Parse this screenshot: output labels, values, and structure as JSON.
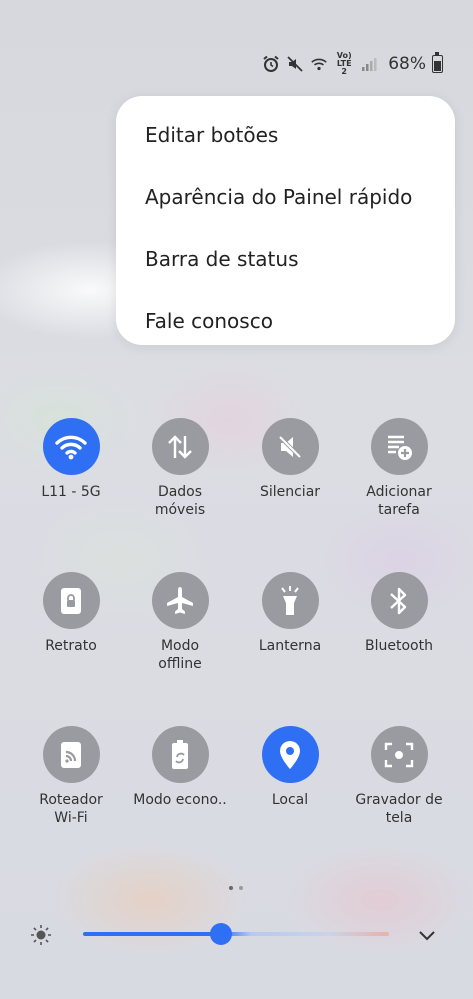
{
  "status_bar": {
    "battery_percent": "68%",
    "network_label": "Vo) LTE2",
    "icons": [
      "alarm-icon",
      "mute-icon",
      "wifi-icon",
      "lte-icon",
      "signal-icon",
      "battery-icon"
    ]
  },
  "menu": {
    "items": [
      {
        "label": "Editar botões"
      },
      {
        "label": "Aparência do Painel rápido"
      },
      {
        "label": "Barra de status"
      },
      {
        "label": "Fale conosco"
      }
    ]
  },
  "tiles": [
    {
      "label": "L11 - 5G",
      "active": true,
      "icon": "wifi-icon"
    },
    {
      "label": "Dados\nmóveis",
      "active": false,
      "icon": "mobile-data-icon"
    },
    {
      "label": "Silenciar",
      "active": false,
      "icon": "mute-icon"
    },
    {
      "label": "Adicionar\ntarefa",
      "active": false,
      "icon": "add-task-icon"
    },
    {
      "label": "Retrato",
      "active": false,
      "icon": "portrait-lock-icon"
    },
    {
      "label": "Modo\noffline",
      "active": false,
      "icon": "airplane-icon"
    },
    {
      "label": "Lanterna",
      "active": false,
      "icon": "flashlight-icon"
    },
    {
      "label": "Bluetooth",
      "active": false,
      "icon": "bluetooth-icon"
    },
    {
      "label": "Roteador\nWi-Fi",
      "active": false,
      "icon": "hotspot-icon"
    },
    {
      "label": "Modo econo..",
      "active": false,
      "icon": "power-saving-icon"
    },
    {
      "label": "Local",
      "active": true,
      "icon": "location-icon"
    },
    {
      "label": "Gravador de\ntela",
      "active": false,
      "icon": "screen-recorder-icon"
    }
  ],
  "pager": {
    "pages": 2,
    "current": 1
  },
  "brightness": {
    "level": 0.45
  },
  "colors": {
    "accent": "#2f6ff3",
    "tile_off": "#9a9ba0",
    "menu_bg": "#ffffff"
  }
}
